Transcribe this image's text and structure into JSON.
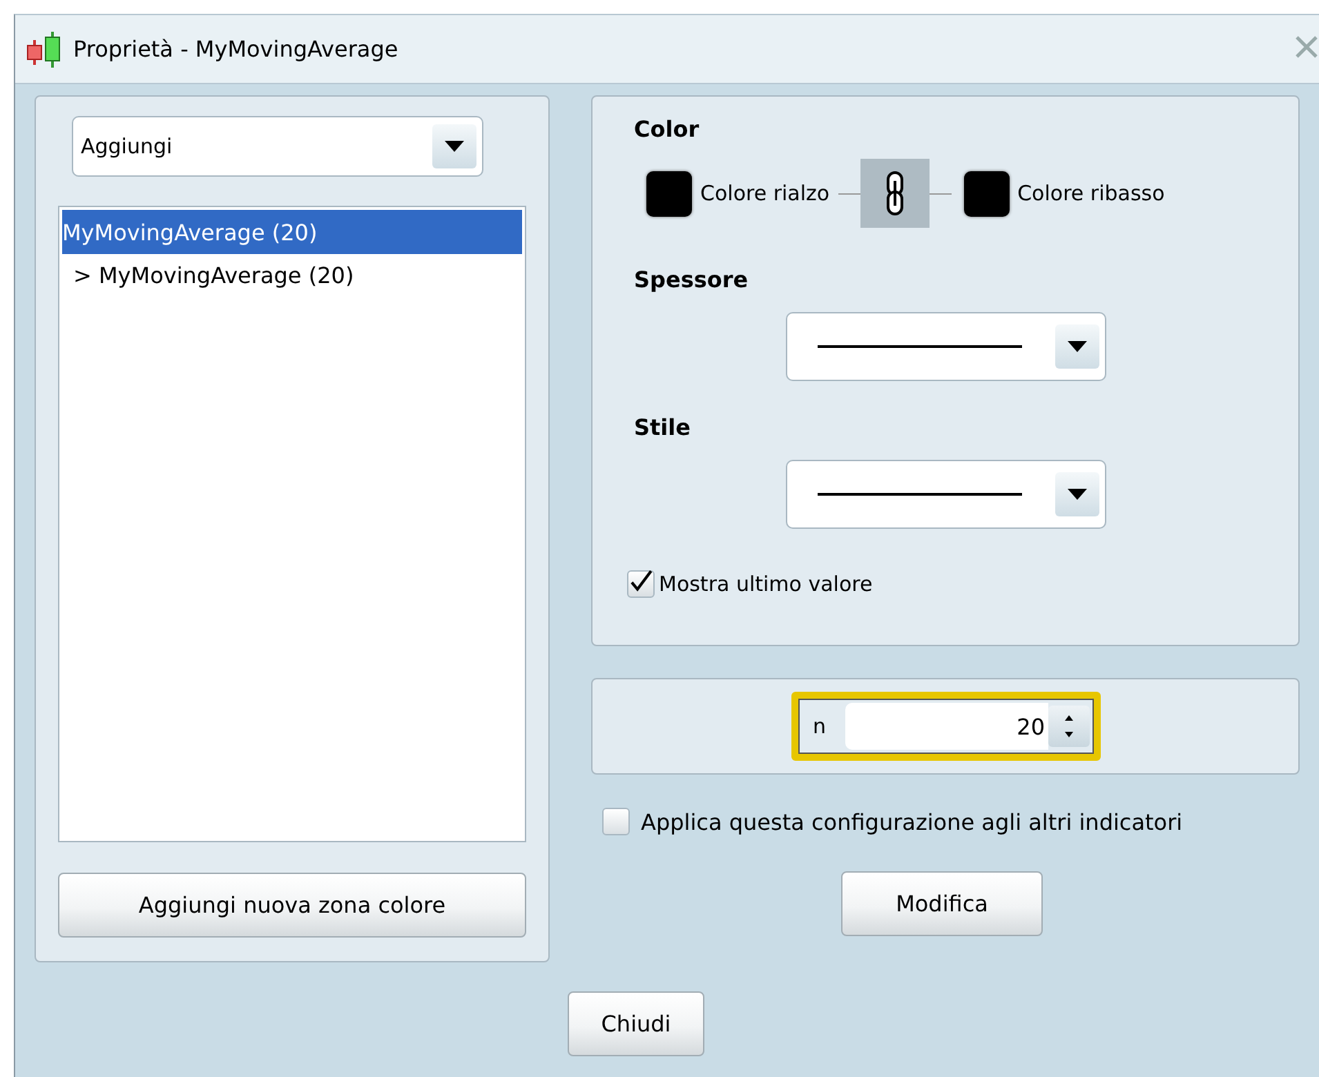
{
  "window": {
    "title": "Proprietà - MyMovingAverage"
  },
  "left": {
    "dropdown": {
      "value": "Aggiungi"
    },
    "list": [
      {
        "label": "MyMovingAverage (20)",
        "selected": true
      },
      {
        "label": "> MyMovingAverage (20)",
        "selected": false
      }
    ],
    "button": "Aggiungi nuova zona colore"
  },
  "style": {
    "color_title": "Color",
    "swatches": [
      {
        "label": "Colore rialzo",
        "color": "#000000"
      },
      {
        "label": "Colore ribasso",
        "color": "#000000"
      }
    ],
    "linked": true,
    "thickness_title": "Spessore",
    "style_title": "Stile",
    "show_last": {
      "label": "Mostra ultimo valore",
      "checked": true
    }
  },
  "param": {
    "label": "n",
    "value": "20",
    "highlighted": true
  },
  "apply": {
    "label": "Applica questa configurazione agli altri indicatori",
    "checked": false
  },
  "modify_button": "Modifica",
  "close_button": "Chiudi"
}
